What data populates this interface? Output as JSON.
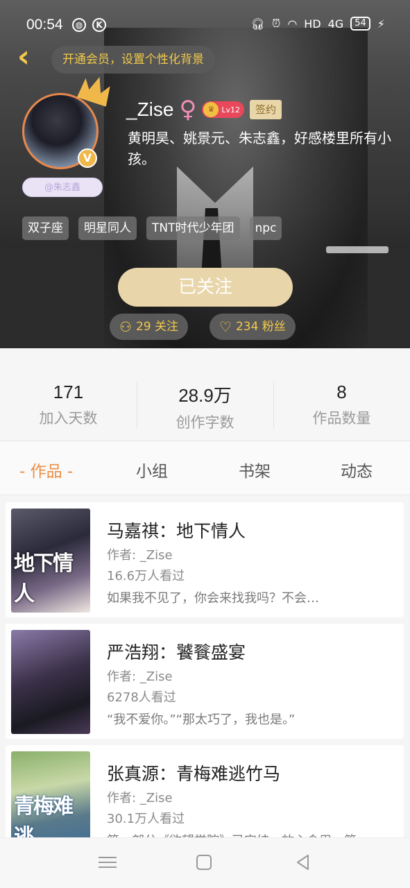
{
  "statusbar": {
    "time": "00:54",
    "icon_1": "globe-icon",
    "icon_2": "k-icon",
    "hd": "HD",
    "net": "4G",
    "battery": "54"
  },
  "header": {
    "back_icon": "chevron-left-icon",
    "vip_tip": "开通会员，设置个性化背景",
    "avatar_tag": "@朱志鑫",
    "username": "_Zise",
    "gender_symbol": "♀",
    "level": "Lv12",
    "sign_badge": "签约",
    "bio": "黄明昊、姚景元、朱志鑫，好感楼里所有小孩。",
    "tags": [
      "双子座",
      "明星同人",
      "TNT时代少年团",
      "npc"
    ],
    "follow_button": "已关注",
    "following_label": "29 关注",
    "followers_label": "234 粉丝"
  },
  "stats": [
    {
      "value": "171",
      "label": "加入天数"
    },
    {
      "value": "28.9万",
      "label": "创作字数"
    },
    {
      "value": "8",
      "label": "作品数量"
    }
  ],
  "tabs": [
    "- 作品 -",
    "小组",
    "书架",
    "动态"
  ],
  "works": [
    {
      "title": "马嘉祺：地下情人",
      "author": "作者: _Zise",
      "views": "16.6万人看过",
      "desc": "如果我不见了，你会来找我吗？不会…",
      "cover_text": "地下情人"
    },
    {
      "title": "严浩翔：饕餮盛宴",
      "author": "作者: _Zise",
      "views": "6278人看过",
      "desc": "“我不爱你。”“那太巧了，我也是。”",
      "cover_text": ""
    },
    {
      "title": "张真源：青梅难逃竹马",
      "author": "作者: _Zise",
      "views": "30.1万人看过",
      "desc": "第一部分《欲望学院》已完结，放心食用，第…",
      "cover_text": "青梅难逃"
    }
  ],
  "colors": {
    "accent": "#ec8d43",
    "gold": "#f2c94c",
    "follow_bg": "#e8d5a9"
  }
}
